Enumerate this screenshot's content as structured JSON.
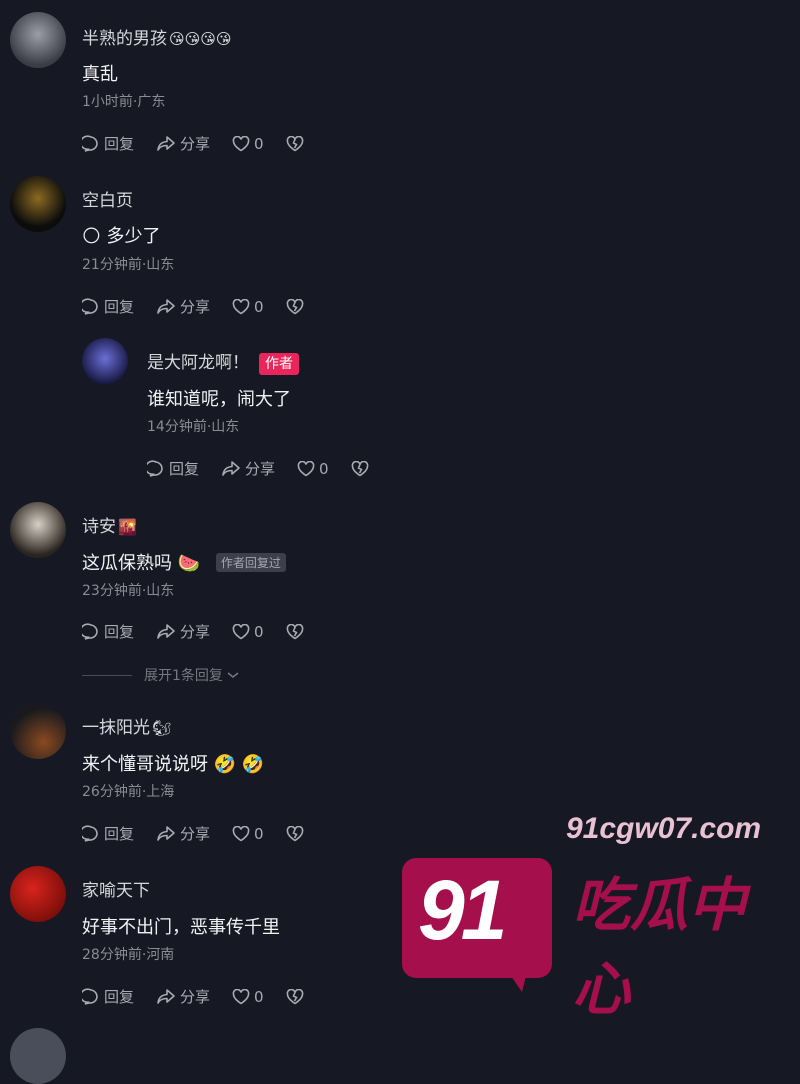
{
  "comments": [
    {
      "user": "半熟的男孩",
      "user_emoji": "😘😘😘😘",
      "text": "真乱",
      "meta": "1小时前·广东",
      "reply": "回复",
      "share": "分享",
      "likes": "0"
    },
    {
      "user": "空白页",
      "user_emoji": "",
      "text": "多少了",
      "text_emoji": "🌕",
      "meta": "21分钟前·山东",
      "reply": "回复",
      "share": "分享",
      "likes": "0"
    },
    {
      "user": "是大阿龙啊！",
      "author_tag": "作者",
      "text": "谁知道呢，闹大了",
      "meta": "14分钟前·山东",
      "reply": "回复",
      "share": "分享",
      "likes": "0"
    },
    {
      "user": "诗安",
      "user_emoji": "🌇",
      "text": "这瓜保熟吗",
      "text_emoji": "🍉",
      "replied_tag": "作者回复过",
      "meta": "23分钟前·山东",
      "reply": "回复",
      "share": "分享",
      "likes": "0"
    },
    {
      "user": "一抹阳光",
      "user_emoji": "🐿",
      "text": "来个懂哥说说呀",
      "text_emoji": "🤣 🤣",
      "meta": "26分钟前·上海",
      "reply": "回复",
      "share": "分享",
      "likes": "0"
    },
    {
      "user": "家喻天下",
      "user_emoji": "",
      "text": "好事不出门，恶事传千里",
      "meta": "28分钟前·河南",
      "reply": "回复",
      "share": "分享",
      "likes": "0"
    }
  ],
  "expand_replies": "展开1条回复",
  "watermark": {
    "number": "91",
    "domain": "91cgw07.com",
    "title": "吃瓜中心"
  },
  "colors": {
    "background": "#161823",
    "author_tag": "#e8265c",
    "watermark": "#a40f4c"
  },
  "icons": [
    "comment-icon",
    "share-icon",
    "heart-icon",
    "broken-heart-icon",
    "chevron-down-icon"
  ]
}
